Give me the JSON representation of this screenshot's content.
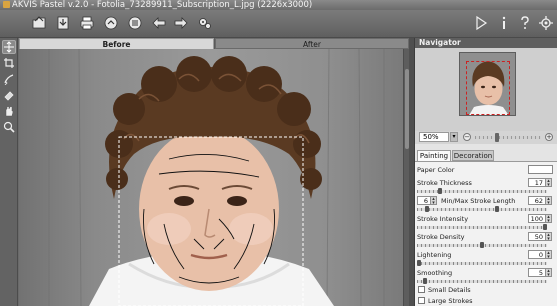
{
  "window": {
    "title": "AKVIS Pastel v.2.0 - Fotolia_73289911_Subscription_L.jpg (2226x3000)"
  },
  "toolbar": {
    "left_icons": [
      "open-icon",
      "save-icon",
      "print-icon",
      "share-icon",
      "batch-icon",
      "undo-icon",
      "redo-icon",
      "preferences-icon"
    ],
    "right_icons": [
      "run-icon",
      "info-icon",
      "help-icon",
      "settings-icon"
    ]
  },
  "tools": {
    "icons": [
      "hand-move-icon",
      "crop-icon",
      "stroke-direction-icon",
      "eraser-icon",
      "hand-icon",
      "zoom-icon"
    ]
  },
  "view_tabs": {
    "before": "Before",
    "after": "After"
  },
  "navigator": {
    "title": "Navigator",
    "zoom": "50%"
  },
  "panel_tabs": {
    "painting": "Painting",
    "decoration": "Decoration"
  },
  "settings": {
    "paper_color_label": "Paper Color",
    "paper_color": "#ffffff",
    "stroke_thickness_label": "Stroke Thickness",
    "stroke_thickness": "17",
    "min_stroke_length": "6",
    "minmax_label": "Min/Max Stroke Length",
    "max_stroke_length": "62",
    "stroke_intensity_label": "Stroke Intensity",
    "stroke_intensity": "100",
    "stroke_density_label": "Stroke Density",
    "stroke_density": "50",
    "lightening_label": "Lightening",
    "lightening": "0",
    "smoothing_label": "Smoothing",
    "smoothing": "5",
    "small_details_label": "Small Details",
    "large_strokes_label": "Large Strokes"
  },
  "slider_levels": {
    "zoom": 0.33,
    "stroke_thickness": 0.17,
    "stroke_length_min": 0.06,
    "stroke_length_max": 0.62,
    "stroke_intensity": 1.0,
    "stroke_density": 0.5,
    "lightening": 0.0,
    "smoothing": 0.05
  },
  "colors": {
    "accent_red": "#cc2222",
    "hair": "#5a3a22",
    "skin": "#e8c0a8"
  }
}
